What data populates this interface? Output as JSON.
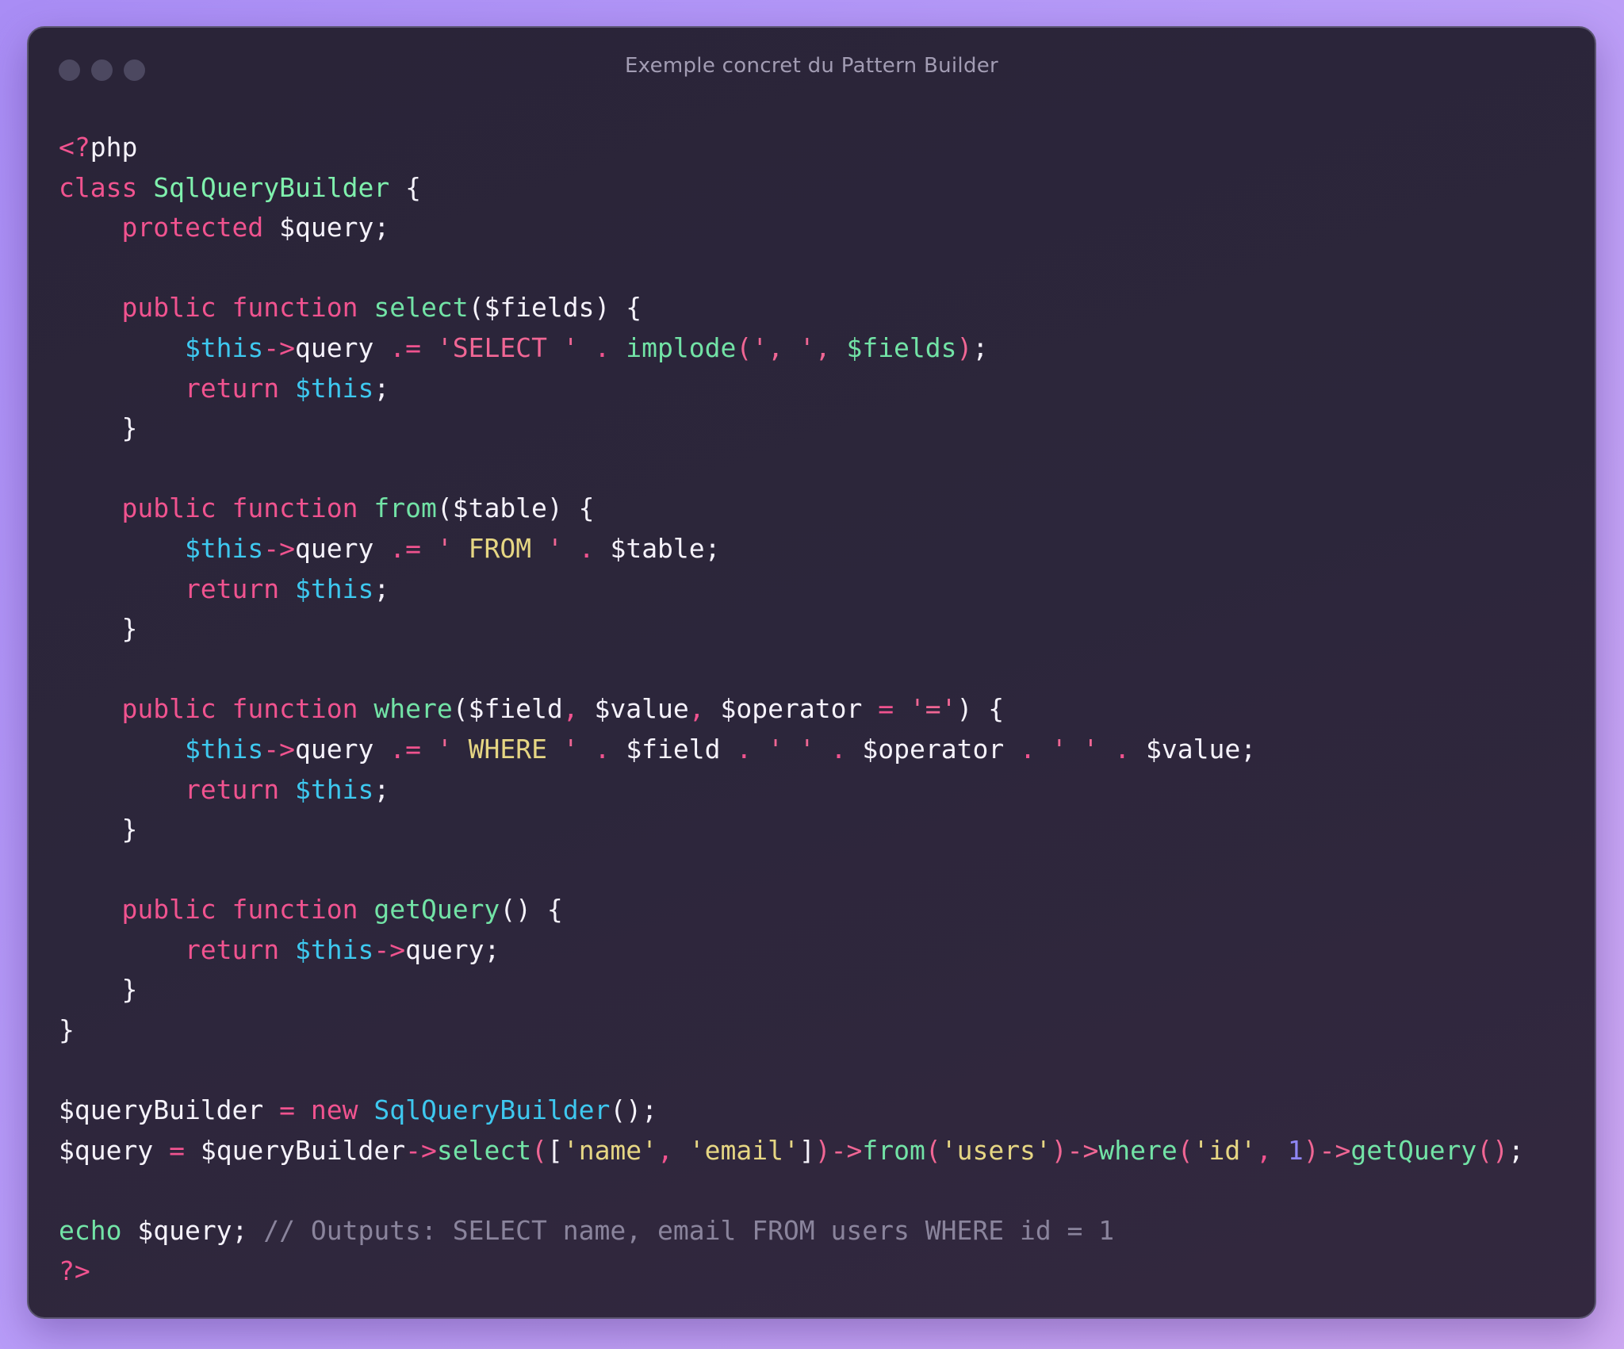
{
  "window": {
    "title": "Exemple concret du Pattern Builder"
  },
  "colors": {
    "background_start": "#a98df5",
    "background_end": "#cda8f2",
    "window_bg": "#2a2438",
    "keyword": "#f0538f",
    "function": "#72e3a6",
    "variable_this": "#3ec8ef",
    "string_yellow": "#e6d683",
    "number": "#8f86f5",
    "comment": "#8a849c",
    "text": "#f5f2fb"
  },
  "code": {
    "language": "php",
    "lines": [
      [
        {
          "t": "<?",
          "c": "kw"
        },
        {
          "t": "php",
          "c": "txt"
        }
      ],
      [
        {
          "t": "class ",
          "c": "kw"
        },
        {
          "t": "SqlQueryBuilder",
          "c": "cls"
        },
        {
          "t": " {",
          "c": "txt"
        }
      ],
      [
        {
          "t": "    protected ",
          "c": "kw"
        },
        {
          "t": "$query;",
          "c": "txt"
        }
      ],
      [],
      [
        {
          "t": "    public function ",
          "c": "kw"
        },
        {
          "t": "select",
          "c": "fn"
        },
        {
          "t": "($fields) {",
          "c": "txt"
        }
      ],
      [
        {
          "t": "        $this",
          "c": "var"
        },
        {
          "t": "->",
          "c": "op"
        },
        {
          "t": "query ",
          "c": "txt"
        },
        {
          "t": ".= ",
          "c": "op"
        },
        {
          "t": "'SELECT ' ",
          "c": "str"
        },
        {
          "t": ". ",
          "c": "op"
        },
        {
          "t": "implode",
          "c": "fn"
        },
        {
          "t": "(', ', ",
          "c": "str"
        },
        {
          "t": "$fields",
          "c": "fn"
        },
        {
          "t": ")",
          "c": "str"
        },
        {
          "t": ";",
          "c": "txt"
        }
      ],
      [
        {
          "t": "        return ",
          "c": "kw"
        },
        {
          "t": "$this",
          "c": "var"
        },
        {
          "t": ";",
          "c": "txt"
        }
      ],
      [
        {
          "t": "    }",
          "c": "txt"
        }
      ],
      [],
      [
        {
          "t": "    public function ",
          "c": "kw"
        },
        {
          "t": "from",
          "c": "fn"
        },
        {
          "t": "($table) {",
          "c": "txt"
        }
      ],
      [
        {
          "t": "        $this",
          "c": "var"
        },
        {
          "t": "->",
          "c": "op"
        },
        {
          "t": "query ",
          "c": "txt"
        },
        {
          "t": ".= ",
          "c": "op"
        },
        {
          "t": "' ",
          "c": "str"
        },
        {
          "t": "FROM",
          "c": "strY"
        },
        {
          "t": " ' ",
          "c": "str"
        },
        {
          "t": ". ",
          "c": "op"
        },
        {
          "t": "$table;",
          "c": "txt"
        }
      ],
      [
        {
          "t": "        return ",
          "c": "kw"
        },
        {
          "t": "$this",
          "c": "var"
        },
        {
          "t": ";",
          "c": "txt"
        }
      ],
      [
        {
          "t": "    }",
          "c": "txt"
        }
      ],
      [],
      [
        {
          "t": "    public function ",
          "c": "kw"
        },
        {
          "t": "where",
          "c": "fn"
        },
        {
          "t": "($field",
          "c": "txt"
        },
        {
          "t": ", ",
          "c": "op"
        },
        {
          "t": "$value",
          "c": "txt"
        },
        {
          "t": ", ",
          "c": "op"
        },
        {
          "t": "$operator ",
          "c": "txt"
        },
        {
          "t": "= ",
          "c": "op"
        },
        {
          "t": "'='",
          "c": "str"
        },
        {
          "t": ") {",
          "c": "txt"
        }
      ],
      [
        {
          "t": "        $this",
          "c": "var"
        },
        {
          "t": "->",
          "c": "op"
        },
        {
          "t": "query ",
          "c": "txt"
        },
        {
          "t": ".= ",
          "c": "op"
        },
        {
          "t": "' ",
          "c": "str"
        },
        {
          "t": "WHERE",
          "c": "strY"
        },
        {
          "t": " ' ",
          "c": "str"
        },
        {
          "t": ". ",
          "c": "op"
        },
        {
          "t": "$field ",
          "c": "txt"
        },
        {
          "t": ". ",
          "c": "op"
        },
        {
          "t": "' ' ",
          "c": "str"
        },
        {
          "t": ". ",
          "c": "op"
        },
        {
          "t": "$operator ",
          "c": "txt"
        },
        {
          "t": ". ",
          "c": "op"
        },
        {
          "t": "' ' ",
          "c": "str"
        },
        {
          "t": ". ",
          "c": "op"
        },
        {
          "t": "$value;",
          "c": "txt"
        }
      ],
      [
        {
          "t": "        return ",
          "c": "kw"
        },
        {
          "t": "$this",
          "c": "var"
        },
        {
          "t": ";",
          "c": "txt"
        }
      ],
      [
        {
          "t": "    }",
          "c": "txt"
        }
      ],
      [],
      [
        {
          "t": "    public function ",
          "c": "kw"
        },
        {
          "t": "getQuery",
          "c": "fn"
        },
        {
          "t": "() {",
          "c": "txt"
        }
      ],
      [
        {
          "t": "        return ",
          "c": "kw"
        },
        {
          "t": "$this",
          "c": "var"
        },
        {
          "t": "->",
          "c": "op"
        },
        {
          "t": "query;",
          "c": "txt"
        }
      ],
      [
        {
          "t": "    }",
          "c": "txt"
        }
      ],
      [
        {
          "t": "}",
          "c": "txt"
        }
      ],
      [],
      [
        {
          "t": "$queryBuilder ",
          "c": "txt"
        },
        {
          "t": "= ",
          "c": "op"
        },
        {
          "t": "new ",
          "c": "kw"
        },
        {
          "t": "SqlQueryBuilder",
          "c": "var"
        },
        {
          "t": "();",
          "c": "txt"
        }
      ],
      [
        {
          "t": "$query ",
          "c": "txt"
        },
        {
          "t": "= ",
          "c": "op"
        },
        {
          "t": "$queryBuilder",
          "c": "txt"
        },
        {
          "t": "->",
          "c": "op"
        },
        {
          "t": "select",
          "c": "fn"
        },
        {
          "t": "(",
          "c": "str"
        },
        {
          "t": "[",
          "c": "txt"
        },
        {
          "t": "'name'",
          "c": "strY"
        },
        {
          "t": ", ",
          "c": "op"
        },
        {
          "t": "'email'",
          "c": "strY"
        },
        {
          "t": "]",
          "c": "txt"
        },
        {
          "t": ")->",
          "c": "str"
        },
        {
          "t": "from",
          "c": "fn"
        },
        {
          "t": "(",
          "c": "str"
        },
        {
          "t": "'users'",
          "c": "strY"
        },
        {
          "t": ")->",
          "c": "str"
        },
        {
          "t": "where",
          "c": "fn"
        },
        {
          "t": "(",
          "c": "str"
        },
        {
          "t": "'id'",
          "c": "strY"
        },
        {
          "t": ", ",
          "c": "op"
        },
        {
          "t": "1",
          "c": "num"
        },
        {
          "t": ")->",
          "c": "str"
        },
        {
          "t": "getQuery",
          "c": "fn"
        },
        {
          "t": "()",
          "c": "str"
        },
        {
          "t": ";",
          "c": "txt"
        }
      ],
      [],
      [
        {
          "t": "echo ",
          "c": "fn"
        },
        {
          "t": "$query; ",
          "c": "txt"
        },
        {
          "t": "// Outputs: SELECT name, email FROM users WHERE id = 1",
          "c": "cmt"
        }
      ],
      [
        {
          "t": "?>",
          "c": "kw"
        }
      ]
    ]
  }
}
